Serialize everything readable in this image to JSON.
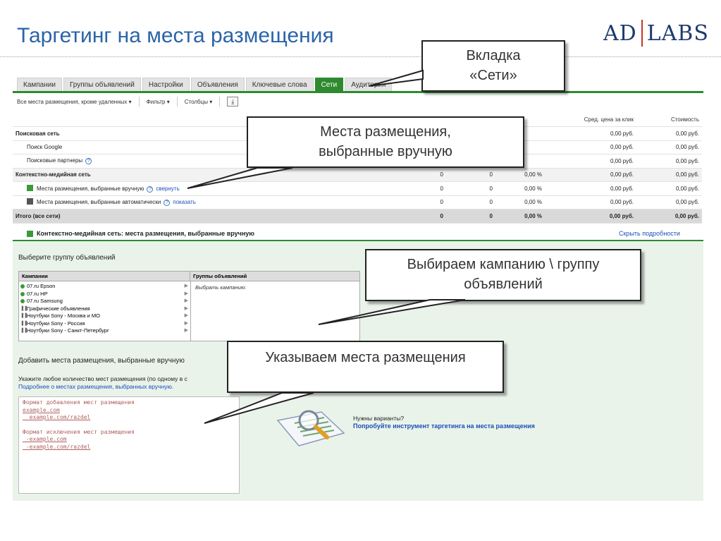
{
  "slide": {
    "title": "Таргетинг на места размещения",
    "logo_left": "AD",
    "logo_right": "LABS"
  },
  "tabs": [
    {
      "label": "Кампании"
    },
    {
      "label": "Группы объявлений"
    },
    {
      "label": "Настройки"
    },
    {
      "label": "Объявления"
    },
    {
      "label": "Ключевые слова"
    },
    {
      "label": "Сети",
      "active": true
    },
    {
      "label": "Аудитория"
    }
  ],
  "toolbar": {
    "filter_select": "Все места размещения, кроме удаленных",
    "filter": "Фильтр",
    "columns": "Столбцы",
    "download_icon": "download-icon"
  },
  "stats": {
    "headers": {
      "avg_cpc": "Сред. цена за клик",
      "cost": "Стоимость"
    },
    "rows": [
      {
        "name": "Поисковая сеть",
        "kind": "group",
        "clicks": "",
        "impr": "",
        "ctr": "",
        "cpc": "0,00 руб.",
        "cost": "0,00 руб."
      },
      {
        "name": "Поиск Google",
        "kind": "sub",
        "clicks": "",
        "impr": "",
        "ctr": "",
        "cpc": "0,00 руб.",
        "cost": "0,00 руб."
      },
      {
        "name": "Поисковые партнеры",
        "kind": "sub",
        "help": true,
        "clicks": "",
        "impr": "",
        "ctr": "",
        "cpc": "0,00 руб.",
        "cost": "0,00 руб."
      },
      {
        "name": "Контекстно-медийная сеть",
        "kind": "group",
        "clicks": "0",
        "impr": "0",
        "ctr": "0,00 %",
        "cpc": "0,00 руб.",
        "cost": "0,00 руб."
      },
      {
        "name": "Места размещения, выбранные вручную",
        "kind": "manual",
        "link": "свернуть",
        "clicks": "0",
        "impr": "0",
        "ctr": "0,00 %",
        "cpc": "0,00 руб.",
        "cost": "0,00 руб."
      },
      {
        "name": "Места размещения, выбранные автоматически",
        "kind": "auto",
        "link": "показать",
        "clicks": "0",
        "impr": "0",
        "ctr": "0,00 %",
        "cpc": "0,00 руб.",
        "cost": "0,00 руб."
      },
      {
        "name": "Итого (все сети)",
        "kind": "total",
        "clicks": "0",
        "impr": "0",
        "ctr": "0,00 %",
        "cpc": "0,00 руб.",
        "cost": "0,00 руб."
      }
    ]
  },
  "section": {
    "title": "Контекстно-медийная сеть: места размещения, выбранные вручную",
    "hide_link": "Скрыть подробности"
  },
  "panel": {
    "choose_label": "Выберите группу объявлений",
    "campaigns_header": "Кампании",
    "adgroups_header": "Группы объявлений",
    "adgroup_placeholder": "Выбрать кампанию:",
    "campaigns": [
      {
        "name": "07.ru Epson",
        "status": "active"
      },
      {
        "name": "07.ru HP",
        "status": "active"
      },
      {
        "name": "07.ru Samsung",
        "status": "active"
      },
      {
        "name": "Графические объявления",
        "status": "paused"
      },
      {
        "name": "Ноутбуки Sony - Москва и МО",
        "status": "paused"
      },
      {
        "name": "Ноутбуки Sony - Россия",
        "status": "paused"
      },
      {
        "name": "Ноутбуки Sony - Санкт-Петербург",
        "status": "paused"
      }
    ],
    "add_label": "Добавить места размещения, выбранные вручную",
    "instructions": "Укажите любое количество мест размещения (по одному в с",
    "more_link": "Подробнее о местах размещения, выбранных вручную.",
    "placements_lines": [
      "Формат добавления мест размещения",
      "example.com",
      "  example.com/razdel",
      "",
      "Формат исключения мест размещения",
      " -example.com",
      " -example.com/razdel"
    ],
    "need_label": "Нужны варианты?",
    "tool_link": "Попробуйте инструмент таргетинга на места размещения"
  },
  "callouts": {
    "tab": [
      "Вкладка",
      "«Сети»"
    ],
    "manual": [
      "Места размещения,",
      "выбранные вручную"
    ],
    "campaign": [
      "Выбираем кампанию \\ группу",
      "объявлений"
    ],
    "placements": [
      "Указываем места размещения"
    ]
  }
}
